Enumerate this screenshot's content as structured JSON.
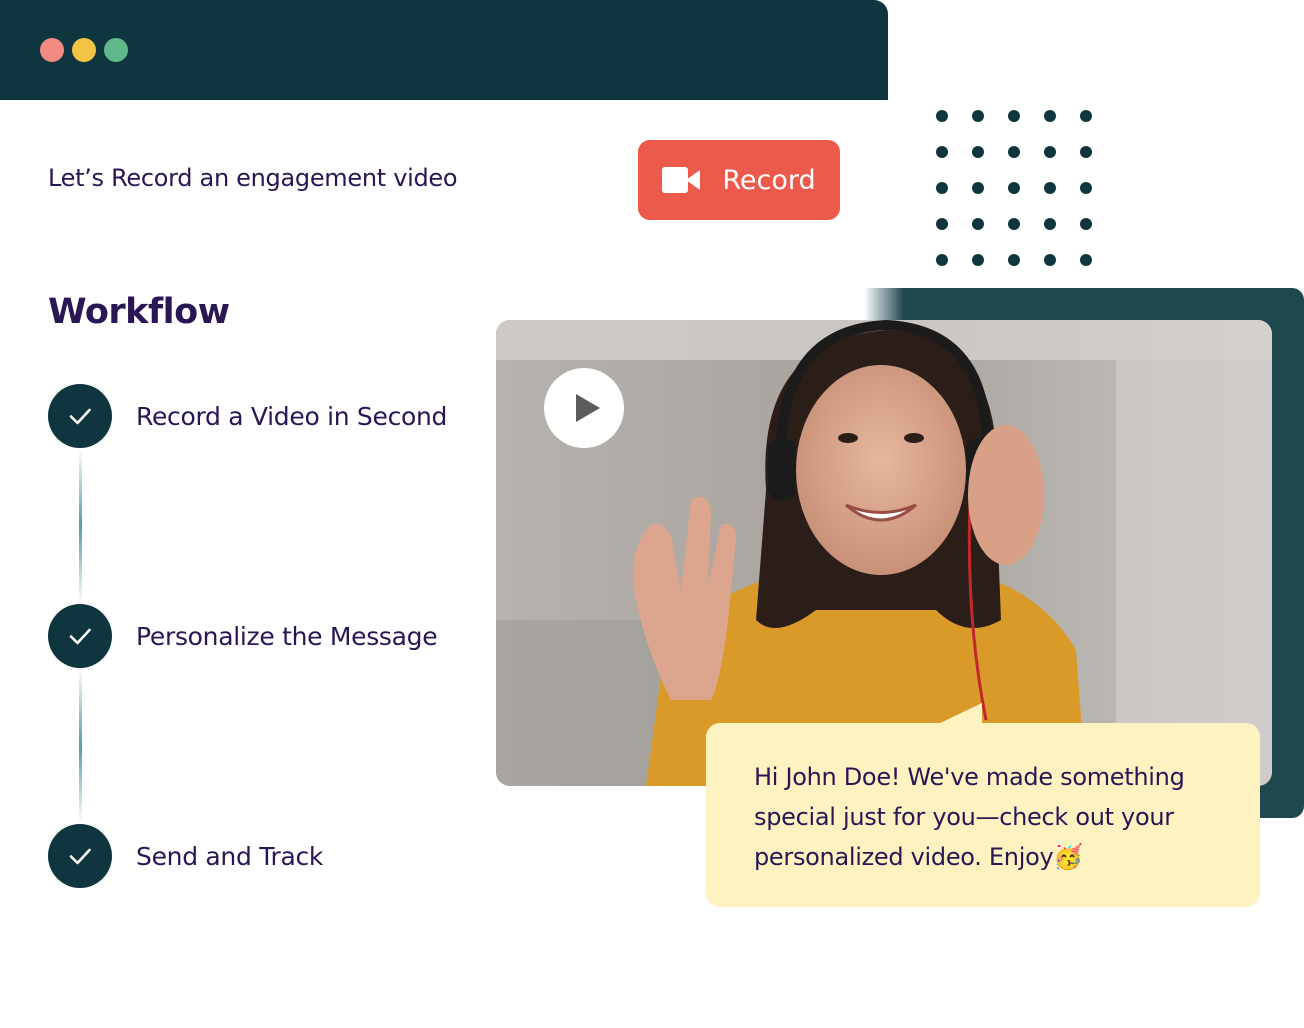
{
  "window": {
    "controls": [
      "close",
      "minimize",
      "maximize"
    ],
    "control_colors": [
      "#f08a83",
      "#f2c443",
      "#5fb78a"
    ],
    "titlebar_color": "#0f363f"
  },
  "header": {
    "headline": "Let’s Record an engagement video",
    "record_button": {
      "label": "Record",
      "icon": "video-camera-icon",
      "color": "#ec5a4b"
    }
  },
  "workflow": {
    "title": "Workflow",
    "steps": [
      {
        "label": "Record a Video in Second",
        "icon": "check-icon"
      },
      {
        "label": "Personalize the Message",
        "icon": "check-icon"
      },
      {
        "label": "Send and Track",
        "icon": "check-icon"
      }
    ]
  },
  "video": {
    "play_icon": "play-icon"
  },
  "message": {
    "text": "Hi John Doe! We've made something special just for you—check out your personalized video. Enjoy🥳"
  }
}
